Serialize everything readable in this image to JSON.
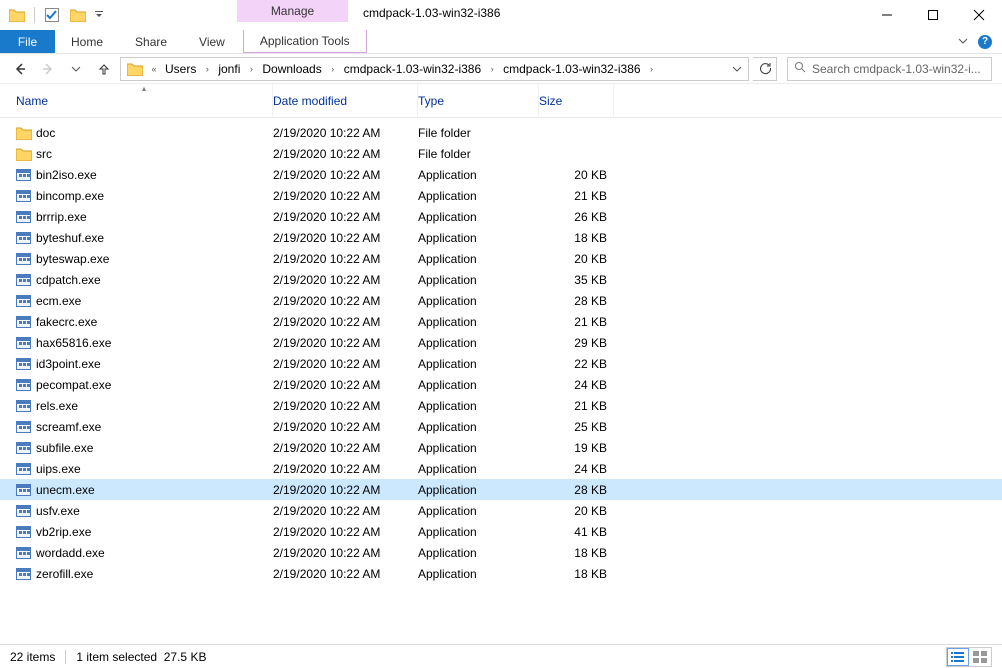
{
  "window": {
    "context_tab": "Manage",
    "title": "cmdpack-1.03-win32-i386"
  },
  "ribbon": {
    "file": "File",
    "home": "Home",
    "share": "Share",
    "view": "View",
    "apptools": "Application Tools"
  },
  "breadcrumbs": {
    "prefix": "«",
    "items": [
      "Users",
      "jonfi",
      "Downloads",
      "cmdpack-1.03-win32-i386",
      "cmdpack-1.03-win32-i386"
    ]
  },
  "search": {
    "placeholder": "Search cmdpack-1.03-win32-i..."
  },
  "columns": {
    "name": "Name",
    "date": "Date modified",
    "type": "Type",
    "size": "Size"
  },
  "rows": [
    {
      "kind": "folder",
      "name": "doc",
      "date": "2/19/2020 10:22 AM",
      "type": "File folder",
      "size": "",
      "selected": false
    },
    {
      "kind": "folder",
      "name": "src",
      "date": "2/19/2020 10:22 AM",
      "type": "File folder",
      "size": "",
      "selected": false
    },
    {
      "kind": "exe",
      "name": "bin2iso.exe",
      "date": "2/19/2020 10:22 AM",
      "type": "Application",
      "size": "20 KB",
      "selected": false
    },
    {
      "kind": "exe",
      "name": "bincomp.exe",
      "date": "2/19/2020 10:22 AM",
      "type": "Application",
      "size": "21 KB",
      "selected": false
    },
    {
      "kind": "exe",
      "name": "brrrip.exe",
      "date": "2/19/2020 10:22 AM",
      "type": "Application",
      "size": "26 KB",
      "selected": false
    },
    {
      "kind": "exe",
      "name": "byteshuf.exe",
      "date": "2/19/2020 10:22 AM",
      "type": "Application",
      "size": "18 KB",
      "selected": false
    },
    {
      "kind": "exe",
      "name": "byteswap.exe",
      "date": "2/19/2020 10:22 AM",
      "type": "Application",
      "size": "20 KB",
      "selected": false
    },
    {
      "kind": "exe",
      "name": "cdpatch.exe",
      "date": "2/19/2020 10:22 AM",
      "type": "Application",
      "size": "35 KB",
      "selected": false
    },
    {
      "kind": "exe",
      "name": "ecm.exe",
      "date": "2/19/2020 10:22 AM",
      "type": "Application",
      "size": "28 KB",
      "selected": false
    },
    {
      "kind": "exe",
      "name": "fakecrc.exe",
      "date": "2/19/2020 10:22 AM",
      "type": "Application",
      "size": "21 KB",
      "selected": false
    },
    {
      "kind": "exe",
      "name": "hax65816.exe",
      "date": "2/19/2020 10:22 AM",
      "type": "Application",
      "size": "29 KB",
      "selected": false
    },
    {
      "kind": "exe",
      "name": "id3point.exe",
      "date": "2/19/2020 10:22 AM",
      "type": "Application",
      "size": "22 KB",
      "selected": false
    },
    {
      "kind": "exe",
      "name": "pecompat.exe",
      "date": "2/19/2020 10:22 AM",
      "type": "Application",
      "size": "24 KB",
      "selected": false
    },
    {
      "kind": "exe",
      "name": "rels.exe",
      "date": "2/19/2020 10:22 AM",
      "type": "Application",
      "size": "21 KB",
      "selected": false
    },
    {
      "kind": "exe",
      "name": "screamf.exe",
      "date": "2/19/2020 10:22 AM",
      "type": "Application",
      "size": "25 KB",
      "selected": false
    },
    {
      "kind": "exe",
      "name": "subfile.exe",
      "date": "2/19/2020 10:22 AM",
      "type": "Application",
      "size": "19 KB",
      "selected": false
    },
    {
      "kind": "exe",
      "name": "uips.exe",
      "date": "2/19/2020 10:22 AM",
      "type": "Application",
      "size": "24 KB",
      "selected": false
    },
    {
      "kind": "exe",
      "name": "unecm.exe",
      "date": "2/19/2020 10:22 AM",
      "type": "Application",
      "size": "28 KB",
      "selected": true
    },
    {
      "kind": "exe",
      "name": "usfv.exe",
      "date": "2/19/2020 10:22 AM",
      "type": "Application",
      "size": "20 KB",
      "selected": false
    },
    {
      "kind": "exe",
      "name": "vb2rip.exe",
      "date": "2/19/2020 10:22 AM",
      "type": "Application",
      "size": "41 KB",
      "selected": false
    },
    {
      "kind": "exe",
      "name": "wordadd.exe",
      "date": "2/19/2020 10:22 AM",
      "type": "Application",
      "size": "18 KB",
      "selected": false
    },
    {
      "kind": "exe",
      "name": "zerofill.exe",
      "date": "2/19/2020 10:22 AM",
      "type": "Application",
      "size": "18 KB",
      "selected": false
    }
  ],
  "status": {
    "count": "22 items",
    "selection": "1 item selected",
    "selsize": "27.5 KB"
  }
}
